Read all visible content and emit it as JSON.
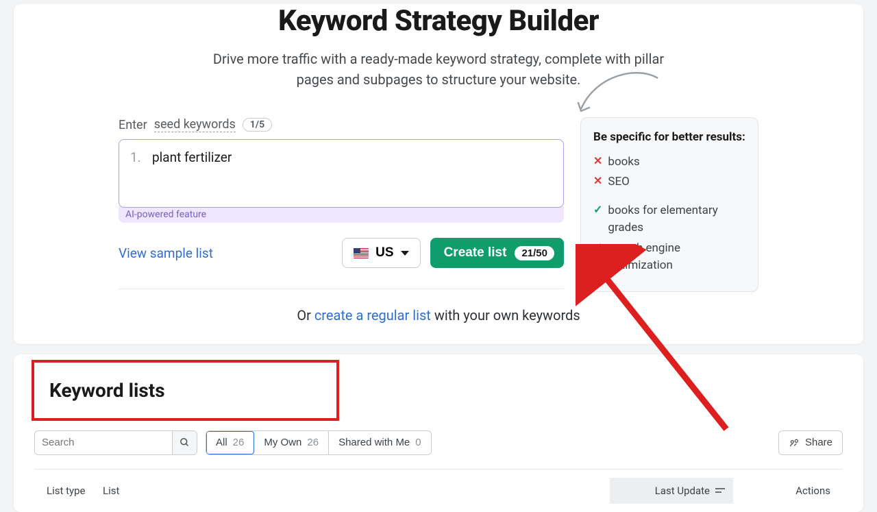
{
  "header": {
    "title": "Keyword Strategy Builder",
    "subtitle": "Drive more traffic with a ready-made keyword strategy, complete with pillar pages and subpages to structure your website."
  },
  "seed": {
    "label_prefix": "Enter",
    "label_underlined": "seed keywords",
    "count": "1/5",
    "items": [
      {
        "num": "1.",
        "value": "plant fertilizer"
      }
    ],
    "ai_caption": "AI-powered feature"
  },
  "actions": {
    "sample_link": "View sample list",
    "country_code": "US",
    "create_label": "Create list",
    "create_badge": "21/50"
  },
  "or_line": {
    "prefix": "Or ",
    "link": "create a regular list",
    "suffix": " with your own keywords"
  },
  "tips": {
    "heading": "Be specific for better results:",
    "bad": [
      "books",
      "SEO"
    ],
    "good": [
      "books for elementary grades",
      "search engine optimization"
    ]
  },
  "lists_section": {
    "heading": "Keyword lists",
    "search_placeholder": "Search",
    "filters": [
      {
        "label": "All",
        "count": "26",
        "active": true
      },
      {
        "label": "My Own",
        "count": "26",
        "active": false
      },
      {
        "label": "Shared with Me",
        "count": "0",
        "active": false
      }
    ],
    "share_label": "Share",
    "columns": {
      "type": "List type",
      "list": "List",
      "update": "Last Update",
      "actions": "Actions"
    }
  }
}
